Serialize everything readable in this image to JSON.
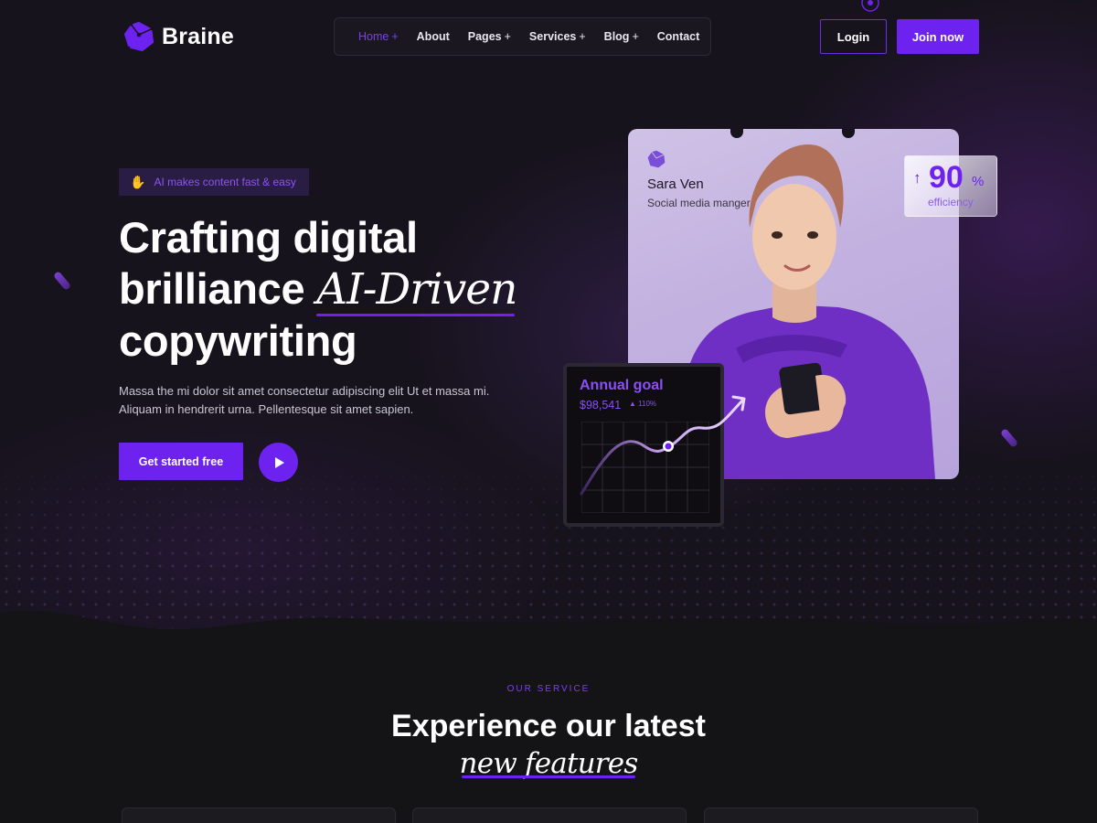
{
  "brand": {
    "name": "Braine"
  },
  "nav": {
    "items": [
      {
        "label": "Home",
        "has_submenu": true,
        "active": true
      },
      {
        "label": "About",
        "has_submenu": false,
        "active": false
      },
      {
        "label": "Pages",
        "has_submenu": true,
        "active": false
      },
      {
        "label": "Services",
        "has_submenu": true,
        "active": false
      },
      {
        "label": "Blog",
        "has_submenu": true,
        "active": false
      },
      {
        "label": "Contact",
        "has_submenu": false,
        "active": false
      }
    ],
    "plus": "+"
  },
  "header": {
    "login_label": "Login",
    "join_label": "Join now"
  },
  "hero": {
    "badge": "AI makes content fast & easy",
    "title_line1": "Crafting digital",
    "title_line2_prefix": "brilliance",
    "title_accent": "AI-Driven",
    "title_line3": "copywriting",
    "description": "Massa the mi dolor sit amet consectetur adipiscing elit Ut et massa mi. Aliquam in hendrerit urna. Pellentesque sit amet sapien.",
    "cta_label": "Get started free"
  },
  "profile": {
    "name": "Sara Ven",
    "role": "Social media manger"
  },
  "stat": {
    "arrow": "↑",
    "value": "90",
    "unit": "%",
    "label": "efficiency"
  },
  "goal": {
    "title": "Annual goal",
    "value": "$98,541",
    "delta": "▲ 110%"
  },
  "services": {
    "tag": "OUR SERVICE",
    "title": "Experience our latest",
    "accent": "new features"
  },
  "colors": {
    "accent": "#6e22f0",
    "background": "#141316",
    "hero_background": "#17131d"
  }
}
